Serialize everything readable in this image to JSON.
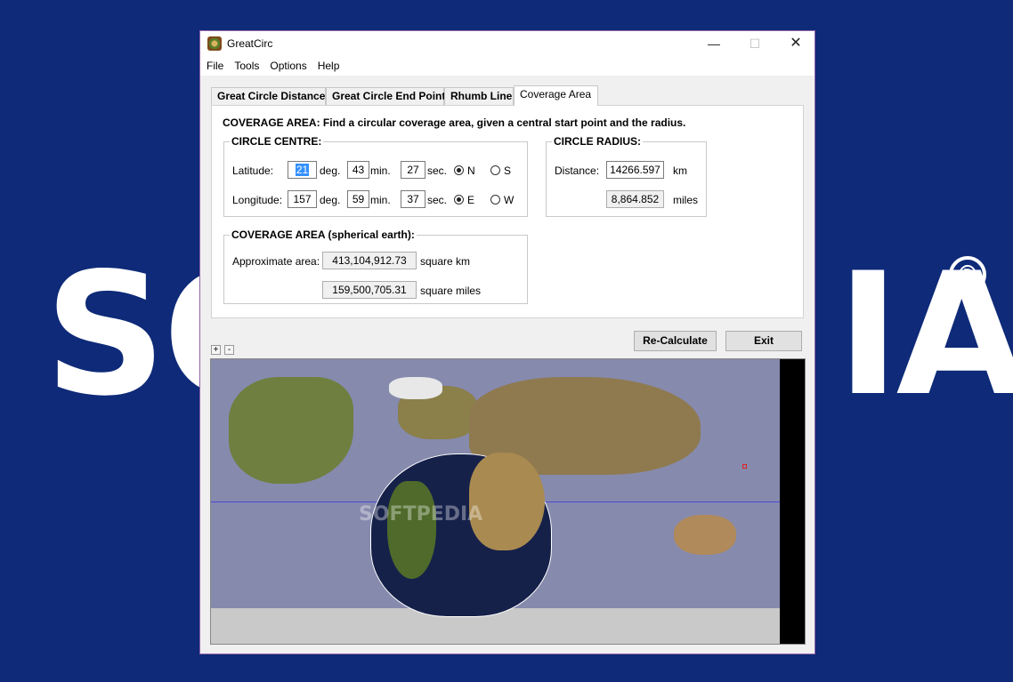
{
  "background": {
    "word_left": "SO",
    "word_right": "IA",
    "reg": "®",
    "color": "#0e2a78"
  },
  "window": {
    "title": "GreatCirc",
    "min": "—",
    "max": "☐",
    "close": "✕"
  },
  "menu": [
    "File",
    "Tools",
    "Options",
    "Help"
  ],
  "tabs": [
    "Great Circle Distance",
    "Great Circle End Point",
    "Rhumb Line",
    "Coverage Area"
  ],
  "active_tab": "Coverage Area",
  "panel": {
    "description": "COVERAGE AREA: Find a circular coverage area, given a central start point and the radius.",
    "centre": {
      "legend": "CIRCLE CENTRE:",
      "lat_label": "Latitude:",
      "lat_deg": "21",
      "lat_min": "43",
      "lat_sec": "27",
      "lon_label": "Longitude:",
      "lon_deg": "157",
      "lon_min": "59",
      "lon_sec": "37",
      "deg": "deg.",
      "min": "min.",
      "sec": "sec.",
      "n": "N",
      "s": "S",
      "e": "E",
      "w": "W"
    },
    "radius": {
      "legend": "CIRCLE RADIUS:",
      "distance_label": "Distance:",
      "km_value": "14266.597",
      "km_unit": "km",
      "miles_value": "8,864.852",
      "miles_unit": "miles"
    },
    "area": {
      "legend": "COVERAGE AREA (spherical earth):",
      "label": "Approximate area:",
      "sqkm_value": "413,104,912.73",
      "sqkm_unit": "square km",
      "sqmi_value": "159,500,705.31",
      "sqmi_unit": "square miles"
    }
  },
  "buttons": {
    "recalc": "Re-Calculate",
    "exit": "Exit",
    "zoom_in": "+",
    "zoom_out": "-"
  },
  "map": {
    "watermark": "SOFTPEDIA"
  }
}
